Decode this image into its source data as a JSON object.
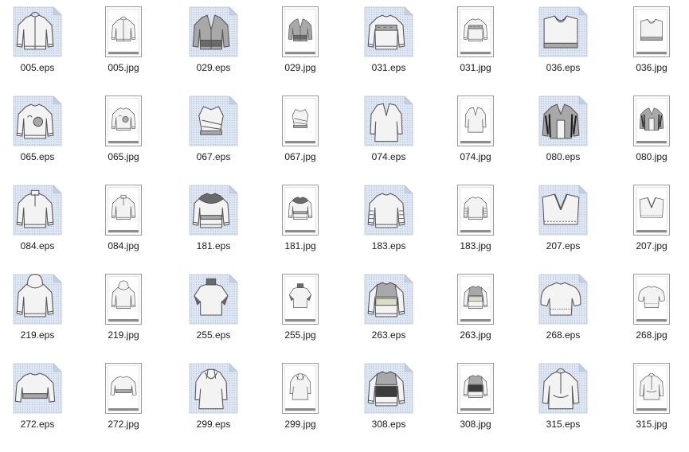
{
  "colors": {
    "eps_paper": "#dde6f2",
    "eps_fold": "#c3cfe0",
    "eps_dot": "#b8c6da",
    "jpg_border": "#9a9a9a",
    "label_text": "#1a1a1a",
    "garment_fill": "#f3f3f3",
    "garment_stroke": "#555555",
    "garment_dark": "#6a6a6a",
    "garment_mid": "#a8a8a8"
  },
  "files": [
    {
      "name": "005.eps",
      "kind": "eps",
      "garment": "hoodie-zip"
    },
    {
      "name": "005.jpg",
      "kind": "jpg",
      "garment": "hoodie-zip"
    },
    {
      "name": "029.eps",
      "kind": "eps",
      "garment": "cardigan-dark"
    },
    {
      "name": "029.jpg",
      "kind": "jpg",
      "garment": "cardigan-dark"
    },
    {
      "name": "031.eps",
      "kind": "eps",
      "garment": "sweater-pattern"
    },
    {
      "name": "031.jpg",
      "kind": "jpg",
      "garment": "sweater-pattern"
    },
    {
      "name": "036.eps",
      "kind": "eps",
      "garment": "vest-wide"
    },
    {
      "name": "036.jpg",
      "kind": "jpg",
      "garment": "vest-wide"
    },
    {
      "name": "065.eps",
      "kind": "eps",
      "garment": "sweater-print"
    },
    {
      "name": "065.jpg",
      "kind": "jpg",
      "garment": "sweater-print"
    },
    {
      "name": "067.eps",
      "kind": "eps",
      "garment": "shrug-knot"
    },
    {
      "name": "067.jpg",
      "kind": "jpg",
      "garment": "shrug-knot"
    },
    {
      "name": "074.eps",
      "kind": "eps",
      "garment": "long-vneck"
    },
    {
      "name": "074.jpg",
      "kind": "jpg",
      "garment": "long-vneck"
    },
    {
      "name": "080.eps",
      "kind": "eps",
      "garment": "jacket-stripe"
    },
    {
      "name": "080.jpg",
      "kind": "jpg",
      "garment": "jacket-stripe"
    },
    {
      "name": "084.eps",
      "kind": "eps",
      "garment": "pullover-zip"
    },
    {
      "name": "084.jpg",
      "kind": "jpg",
      "garment": "pullover-zip"
    },
    {
      "name": "181.eps",
      "kind": "eps",
      "garment": "sweater-yoke"
    },
    {
      "name": "181.jpg",
      "kind": "jpg",
      "garment": "sweater-yoke"
    },
    {
      "name": "183.eps",
      "kind": "eps",
      "garment": "sweater-stripe-sleeve"
    },
    {
      "name": "183.jpg",
      "kind": "jpg",
      "garment": "sweater-stripe-sleeve"
    },
    {
      "name": "207.eps",
      "kind": "eps",
      "garment": "vest-v"
    },
    {
      "name": "207.jpg",
      "kind": "jpg",
      "garment": "vest-v"
    },
    {
      "name": "219.eps",
      "kind": "eps",
      "garment": "hoodie"
    },
    {
      "name": "219.jpg",
      "kind": "jpg",
      "garment": "hoodie"
    },
    {
      "name": "255.eps",
      "kind": "eps",
      "garment": "turtleneck-short"
    },
    {
      "name": "255.jpg",
      "kind": "jpg",
      "garment": "turtleneck-short"
    },
    {
      "name": "263.eps",
      "kind": "eps",
      "garment": "sweater-colorblock"
    },
    {
      "name": "263.jpg",
      "kind": "jpg",
      "garment": "sweater-colorblock"
    },
    {
      "name": "268.eps",
      "kind": "eps",
      "garment": "sweater-puff"
    },
    {
      "name": "268.jpg",
      "kind": "jpg",
      "garment": "sweater-puff"
    },
    {
      "name": "272.eps",
      "kind": "eps",
      "garment": "sweater-crop"
    },
    {
      "name": "272.jpg",
      "kind": "jpg",
      "garment": "sweater-crop"
    },
    {
      "name": "299.eps",
      "kind": "eps",
      "garment": "tunic-cowl"
    },
    {
      "name": "299.jpg",
      "kind": "jpg",
      "garment": "tunic-cowl"
    },
    {
      "name": "308.eps",
      "kind": "eps",
      "garment": "sweater-block-dark"
    },
    {
      "name": "308.jpg",
      "kind": "jpg",
      "garment": "sweater-block-dark"
    },
    {
      "name": "315.eps",
      "kind": "eps",
      "garment": "anorak"
    },
    {
      "name": "315.jpg",
      "kind": "jpg",
      "garment": "anorak"
    }
  ]
}
